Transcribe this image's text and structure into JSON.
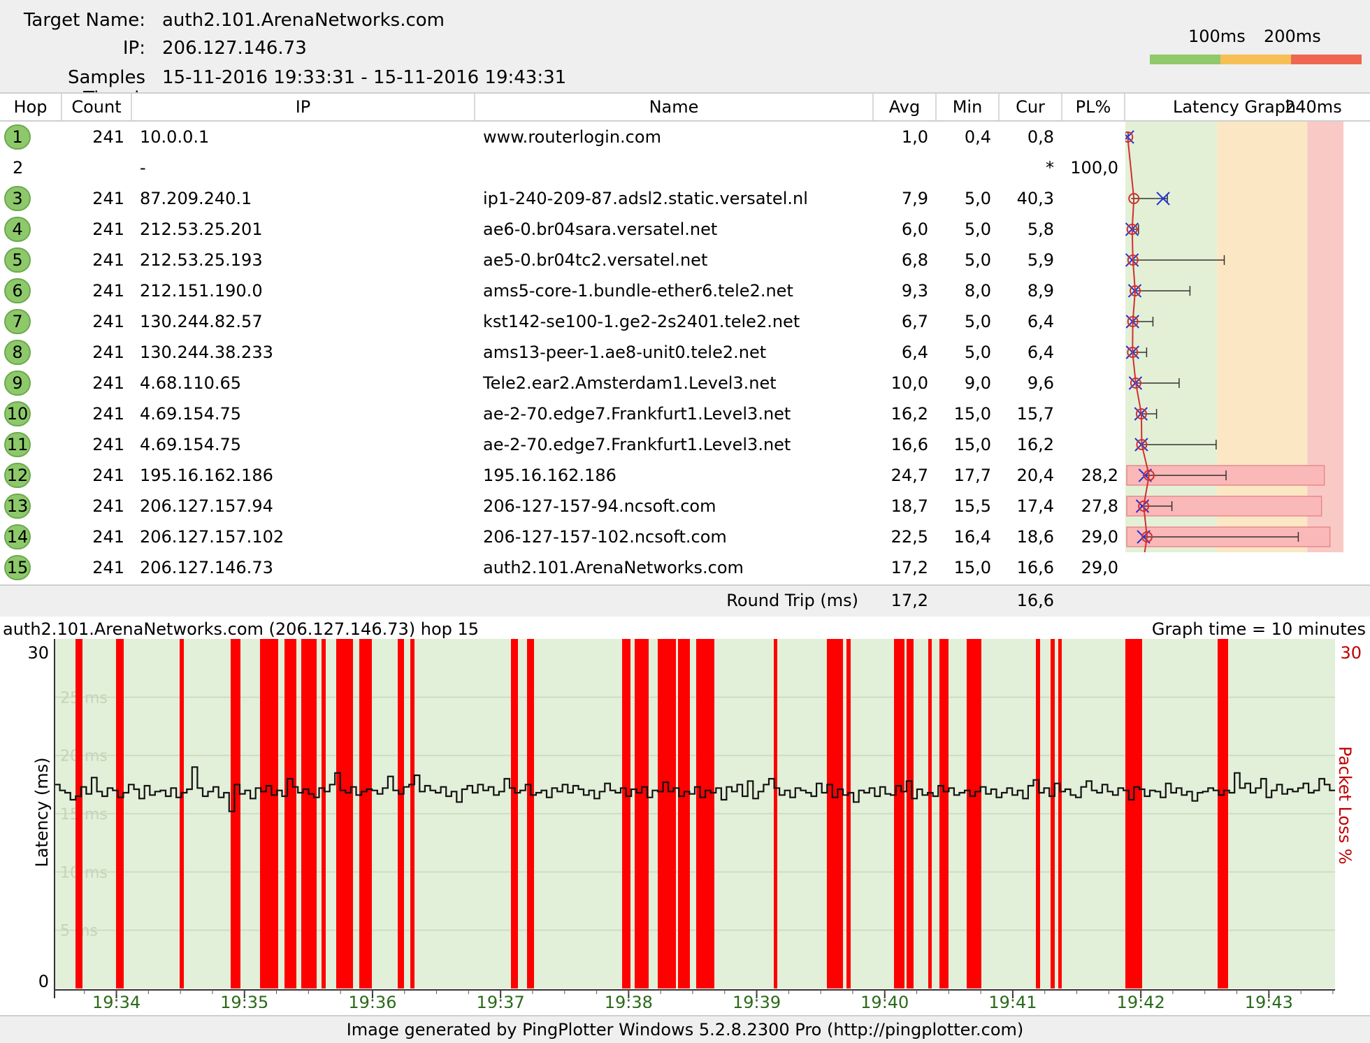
{
  "header": {
    "target_label": "Target Name:",
    "target_value": "auth2.101.ArenaNetworks.com",
    "ip_label": "IP:",
    "ip_value": "206.127.146.73",
    "samples_label": "Samples Timed:",
    "samples_value": "15-11-2016 19:33:31 - 15-11-2016 19:43:31",
    "scale_100": "100ms",
    "scale_200": "200ms",
    "scale_colors": [
      "#91c96a",
      "#f7bf56",
      "#ee6650"
    ]
  },
  "columns": {
    "hop": "Hop",
    "count": "Count",
    "ip": "IP",
    "name": "Name",
    "avg": "Avg",
    "min": "Min",
    "cur": "Cur",
    "pl": "PL%",
    "graph": "Latency Graph",
    "graph_max": "240ms"
  },
  "rows": [
    {
      "hop": "1",
      "count": "241",
      "ip": "10.0.0.1",
      "name": "www.routerlogin.com",
      "avg": "1,0",
      "min": "0,4",
      "cur": "0,8",
      "pl": ""
    },
    {
      "hop": "2",
      "count": "",
      "ip": "-",
      "name": "",
      "avg": "",
      "min": "",
      "cur": "*",
      "pl": "100,0"
    },
    {
      "hop": "3",
      "count": "241",
      "ip": "87.209.240.1",
      "name": "ip1-240-209-87.adsl2.static.versatel.nl",
      "avg": "7,9",
      "min": "5,0",
      "cur": "40,3",
      "pl": ""
    },
    {
      "hop": "4",
      "count": "241",
      "ip": "212.53.25.201",
      "name": "ae6-0.br04sara.versatel.net",
      "avg": "6,0",
      "min": "5,0",
      "cur": "5,8",
      "pl": ""
    },
    {
      "hop": "5",
      "count": "241",
      "ip": "212.53.25.193",
      "name": "ae5-0.br04tc2.versatel.net",
      "avg": "6,8",
      "min": "5,0",
      "cur": "5,9",
      "pl": ""
    },
    {
      "hop": "6",
      "count": "241",
      "ip": "212.151.190.0",
      "name": "ams5-core-1.bundle-ether6.tele2.net",
      "avg": "9,3",
      "min": "8,0",
      "cur": "8,9",
      "pl": ""
    },
    {
      "hop": "7",
      "count": "241",
      "ip": "130.244.82.57",
      "name": "kst142-se100-1.ge2-2s2401.tele2.net",
      "avg": "6,7",
      "min": "5,0",
      "cur": "6,4",
      "pl": ""
    },
    {
      "hop": "8",
      "count": "241",
      "ip": "130.244.38.233",
      "name": "ams13-peer-1.ae8-unit0.tele2.net",
      "avg": "6,4",
      "min": "5,0",
      "cur": "6,4",
      "pl": ""
    },
    {
      "hop": "9",
      "count": "241",
      "ip": "4.68.110.65",
      "name": "Tele2.ear2.Amsterdam1.Level3.net",
      "avg": "10,0",
      "min": "9,0",
      "cur": "9,6",
      "pl": ""
    },
    {
      "hop": "10",
      "count": "241",
      "ip": "4.69.154.75",
      "name": "ae-2-70.edge7.Frankfurt1.Level3.net",
      "avg": "16,2",
      "min": "15,0",
      "cur": "15,7",
      "pl": ""
    },
    {
      "hop": "11",
      "count": "241",
      "ip": "4.69.154.75",
      "name": "ae-2-70.edge7.Frankfurt1.Level3.net",
      "avg": "16,6",
      "min": "15,0",
      "cur": "16,2",
      "pl": ""
    },
    {
      "hop": "12",
      "count": "241",
      "ip": "195.16.162.186",
      "name": "195.16.162.186",
      "avg": "24,7",
      "min": "17,7",
      "cur": "20,4",
      "pl": "28,2"
    },
    {
      "hop": "13",
      "count": "241",
      "ip": "206.127.157.94",
      "name": "206-127-157-94.ncsoft.com",
      "avg": "18,7",
      "min": "15,5",
      "cur": "17,4",
      "pl": "27,8"
    },
    {
      "hop": "14",
      "count": "241",
      "ip": "206.127.157.102",
      "name": "206-127-157-102.ncsoft.com",
      "avg": "22,5",
      "min": "16,4",
      "cur": "18,6",
      "pl": "29,0"
    },
    {
      "hop": "15",
      "count": "241",
      "ip": "206.127.146.73",
      "name": "auth2.101.ArenaNetworks.com",
      "avg": "17,2",
      "min": "15,0",
      "cur": "16,6",
      "pl": "29,0"
    }
  ],
  "latency_graph": {
    "max_ms": 240,
    "hops": [
      {
        "avg": 1.0,
        "min": 0.4,
        "max": 1.5,
        "cur": 0.8,
        "pl": 0
      },
      {
        "avg": null,
        "min": null,
        "max": null,
        "cur": null,
        "pl": 100
      },
      {
        "avg": 7.9,
        "min": 5.0,
        "max": 45,
        "cur": 40.3,
        "pl": 0
      },
      {
        "avg": 6.0,
        "min": 5.0,
        "max": 13,
        "cur": 5.8,
        "pl": 0
      },
      {
        "avg": 6.8,
        "min": 5.0,
        "max": 108,
        "cur": 5.9,
        "pl": 0
      },
      {
        "avg": 9.3,
        "min": 8.0,
        "max": 70,
        "cur": 8.9,
        "pl": 0
      },
      {
        "avg": 6.7,
        "min": 5.0,
        "max": 29,
        "cur": 6.4,
        "pl": 0
      },
      {
        "avg": 6.4,
        "min": 5.0,
        "max": 22,
        "cur": 6.4,
        "pl": 0
      },
      {
        "avg": 10.0,
        "min": 9.0,
        "max": 58,
        "cur": 9.6,
        "pl": 0
      },
      {
        "avg": 16.2,
        "min": 15.0,
        "max": 33,
        "cur": 15.7,
        "pl": 0
      },
      {
        "avg": 16.6,
        "min": 15.0,
        "max": 99,
        "cur": 16.2,
        "pl": 0
      },
      {
        "avg": 24.7,
        "min": 17.7,
        "max": 110,
        "cur": 20.4,
        "pl": 28.2
      },
      {
        "avg": 18.7,
        "min": 15.5,
        "max": 50,
        "cur": 17.4,
        "pl": 27.8
      },
      {
        "avg": 22.5,
        "min": 16.4,
        "max": 190,
        "cur": 18.6,
        "pl": 29.0
      },
      {
        "avg": 17.2,
        "min": 15.0,
        "max": 20,
        "cur": 16.6,
        "pl": 29.0
      }
    ]
  },
  "round_trip": {
    "label": "Round Trip (ms)",
    "avg": "17,2",
    "cur": "16,6"
  },
  "bottom": {
    "title": "auth2.101.ArenaNetworks.com (206.127.146.73) hop 15",
    "graph_time": "Graph time = 10 minutes",
    "y_axis_label": "Latency (ms)",
    "y2_axis_label": "Packet Loss %",
    "y_max_label": "30",
    "y_min_label": "0",
    "y2_max_label": "30",
    "grid_labels": [
      "25 ms",
      "20 ms",
      "15 ms",
      "10 ms",
      "5 ms"
    ]
  },
  "chart_data": {
    "type": "line",
    "title": "auth2.101.ArenaNetworks.com (206.127.146.73) hop 15",
    "xlabel": "",
    "ylabel": "Latency (ms)",
    "y2label": "Packet Loss %",
    "ylim": [
      0,
      30
    ],
    "xlim": [
      "19:33:31",
      "19:43:31"
    ],
    "x_ticks": [
      "19:34",
      "19:35",
      "19:36",
      "19:37",
      "19:38",
      "19:39",
      "19:40",
      "19:41",
      "19:42",
      "19:43"
    ],
    "grid": true,
    "series": [
      {
        "values": [
          17.5,
          17.0,
          16.8,
          16.2,
          16.5,
          17.3,
          16.7,
          18.1,
          16.9,
          16.5,
          17.2,
          17.0,
          16.4,
          16.8,
          17.5,
          17.1,
          16.3,
          17.4,
          16.6,
          16.9,
          17.0,
          16.5,
          17.2,
          16.4,
          16.8,
          17.1,
          19.0,
          17.2,
          16.5,
          16.9,
          17.3,
          16.4,
          16.8,
          15.2,
          17.5,
          16.7,
          17.0,
          16.3,
          17.2,
          16.9,
          17.4,
          16.6,
          17.0,
          16.5,
          18.0,
          17.3,
          16.8,
          17.1,
          16.7,
          16.4,
          17.2,
          16.9,
          17.5,
          18.5,
          17.0,
          16.8,
          17.3,
          16.6,
          16.9,
          17.1,
          17.0,
          16.7,
          17.2,
          18.2,
          17.0,
          16.7,
          17.3,
          17.5,
          18.3,
          16.9,
          17.4,
          17.0,
          16.8,
          17.3,
          16.5,
          16.9,
          16.0,
          17.1,
          17.4,
          16.8,
          17.5,
          17.0,
          17.3,
          16.6,
          16.9,
          18.0,
          17.2,
          16.8,
          17.0,
          17.5,
          16.6,
          16.8,
          17.0,
          16.4,
          17.2,
          16.9,
          17.5,
          16.8,
          17.4,
          17.1,
          16.6,
          17.0,
          16.3,
          16.9,
          17.6,
          17.0,
          16.8,
          17.2,
          16.5,
          17.1,
          16.8,
          17.3,
          16.4,
          17.0,
          16.9,
          17.7,
          16.9,
          17.2,
          16.5,
          16.9,
          16.7,
          17.3,
          16.4,
          17.0,
          16.8,
          17.2,
          16.2,
          17.3,
          16.9,
          17.5,
          16.5,
          17.8,
          16.3,
          16.9,
          17.5,
          18.0,
          17.2,
          16.6,
          17.0,
          16.4,
          17.2,
          17.0,
          16.8,
          16.5,
          17.6,
          16.8,
          17.5,
          16.4,
          17.1,
          16.6,
          16.8,
          16.0,
          17.0,
          16.8,
          17.2,
          16.5,
          17.3,
          16.7,
          16.6,
          17.4,
          16.9,
          17.8,
          16.3,
          17.1,
          16.6,
          16.8,
          16.5,
          17.4,
          16.9,
          17.2,
          16.6,
          16.8,
          17.0,
          16.5,
          16.9,
          17.3,
          16.7,
          17.1,
          16.4,
          16.8,
          17.2,
          16.6,
          17.0,
          16.3,
          17.4,
          17.9,
          16.8,
          17.2,
          16.5,
          17.6,
          16.9,
          17.1,
          16.6,
          16.4,
          17.3,
          17.8,
          17.0,
          16.8,
          17.5,
          16.9,
          16.6,
          17.2,
          17.0,
          16.2,
          17.3,
          17.1,
          16.5,
          17.0,
          16.9,
          16.4,
          17.6,
          16.8,
          17.2,
          16.6,
          16.9,
          16.1,
          16.8,
          16.9,
          17.2,
          17.0,
          16.6,
          17.0,
          16.8,
          18.5,
          17.2,
          17.6,
          16.8,
          17.2,
          18.0,
          16.4,
          17.0,
          17.5,
          16.7,
          17.1,
          16.9,
          17.2,
          17.6,
          16.8,
          17.0,
          18.0,
          17.5,
          17.0
        ]
      }
    ],
    "packet_loss_color": "#ff0000"
  },
  "footer": {
    "text": "Image generated by PingPlotter Windows 5.2.8.2300 Pro (http://pingplotter.com)"
  }
}
